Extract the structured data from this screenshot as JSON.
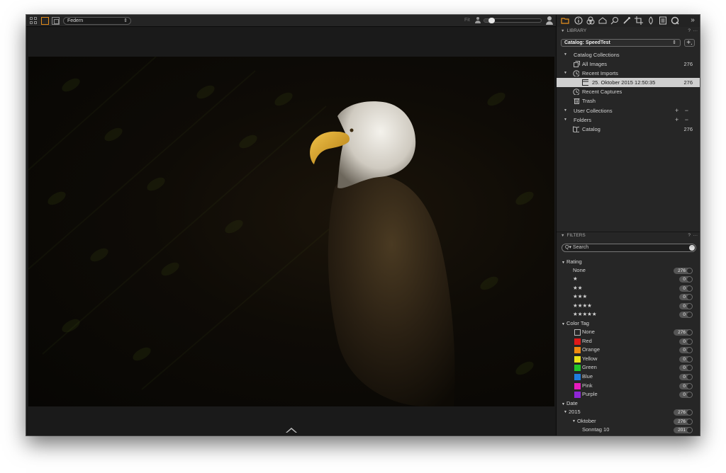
{
  "toolbar": {
    "variant_select_value": "Federn",
    "select_arrows": "⇕",
    "fit_label": "Fit",
    "zoom_fraction": 0.12
  },
  "tool_tabs": [
    {
      "name": "library-tab-icon",
      "active": true
    },
    {
      "name": "info-tab-icon"
    },
    {
      "name": "color-tab-icon"
    },
    {
      "name": "exposure-tab-icon"
    },
    {
      "name": "lens-tab-icon"
    },
    {
      "name": "details-tab-icon"
    },
    {
      "name": "crop-tab-icon"
    },
    {
      "name": "adjustments-tab-icon"
    },
    {
      "name": "metadata-tab-icon"
    },
    {
      "name": "output-tab-icon"
    },
    {
      "name": "more-tabs-icon"
    }
  ],
  "library": {
    "title": "LIBRARY",
    "help": "?",
    "more": "···",
    "catalog_select": "Catalog: SpeedTest",
    "add_label": "+.",
    "rows": [
      {
        "label": "Catalog Collections",
        "tri": "▼",
        "count": ""
      },
      {
        "label": "All Images",
        "count": "276"
      },
      {
        "label": "Recent Imports",
        "tri": "▼",
        "count": ""
      },
      {
        "label": "25. Oktober 2015 12:50:35",
        "count": "276",
        "selected": true
      },
      {
        "label": "Recent Captures",
        "count": ""
      },
      {
        "label": "Trash",
        "count": ""
      },
      {
        "label": "User Collections",
        "tri": "▼",
        "pm": "+ −"
      },
      {
        "label": "Folders",
        "tri": "▼",
        "pm": "+ −"
      },
      {
        "label": "Catalog",
        "count": "276"
      }
    ]
  },
  "filters": {
    "title": "FILTERS",
    "help": "?",
    "more": "···",
    "search_placeholder": "Search",
    "search_prefix": "Q▾",
    "search_more": "···",
    "rating_header": "Rating",
    "rating_rows": [
      {
        "label": "None",
        "count": "276"
      },
      {
        "label": "★",
        "count": "0"
      },
      {
        "label": "★★",
        "count": "0"
      },
      {
        "label": "★★★",
        "count": "0"
      },
      {
        "label": "★★★★",
        "count": "0"
      },
      {
        "label": "★★★★★",
        "count": "0"
      }
    ],
    "color_header": "Color Tag",
    "color_rows": [
      {
        "label": "None",
        "count": "276",
        "color": "#262626"
      },
      {
        "label": "Red",
        "count": "0",
        "color": "#e01919"
      },
      {
        "label": "Orange",
        "count": "0",
        "color": "#ef8a10"
      },
      {
        "label": "Yellow",
        "count": "0",
        "color": "#e9e21a"
      },
      {
        "label": "Green",
        "count": "0",
        "color": "#22c52a"
      },
      {
        "label": "Blue",
        "count": "0",
        "color": "#1f7de0"
      },
      {
        "label": "Pink",
        "count": "0",
        "color": "#e61bbd"
      },
      {
        "label": "Purple",
        "count": "0",
        "color": "#8e26d6"
      }
    ],
    "date_header": "Date",
    "date_rows": [
      {
        "label": "2015",
        "count": "276",
        "tri": "▼"
      },
      {
        "label": "Oktober",
        "count": "276",
        "tri": "▼"
      },
      {
        "label": "Sonntag 10",
        "count": "201"
      }
    ]
  }
}
